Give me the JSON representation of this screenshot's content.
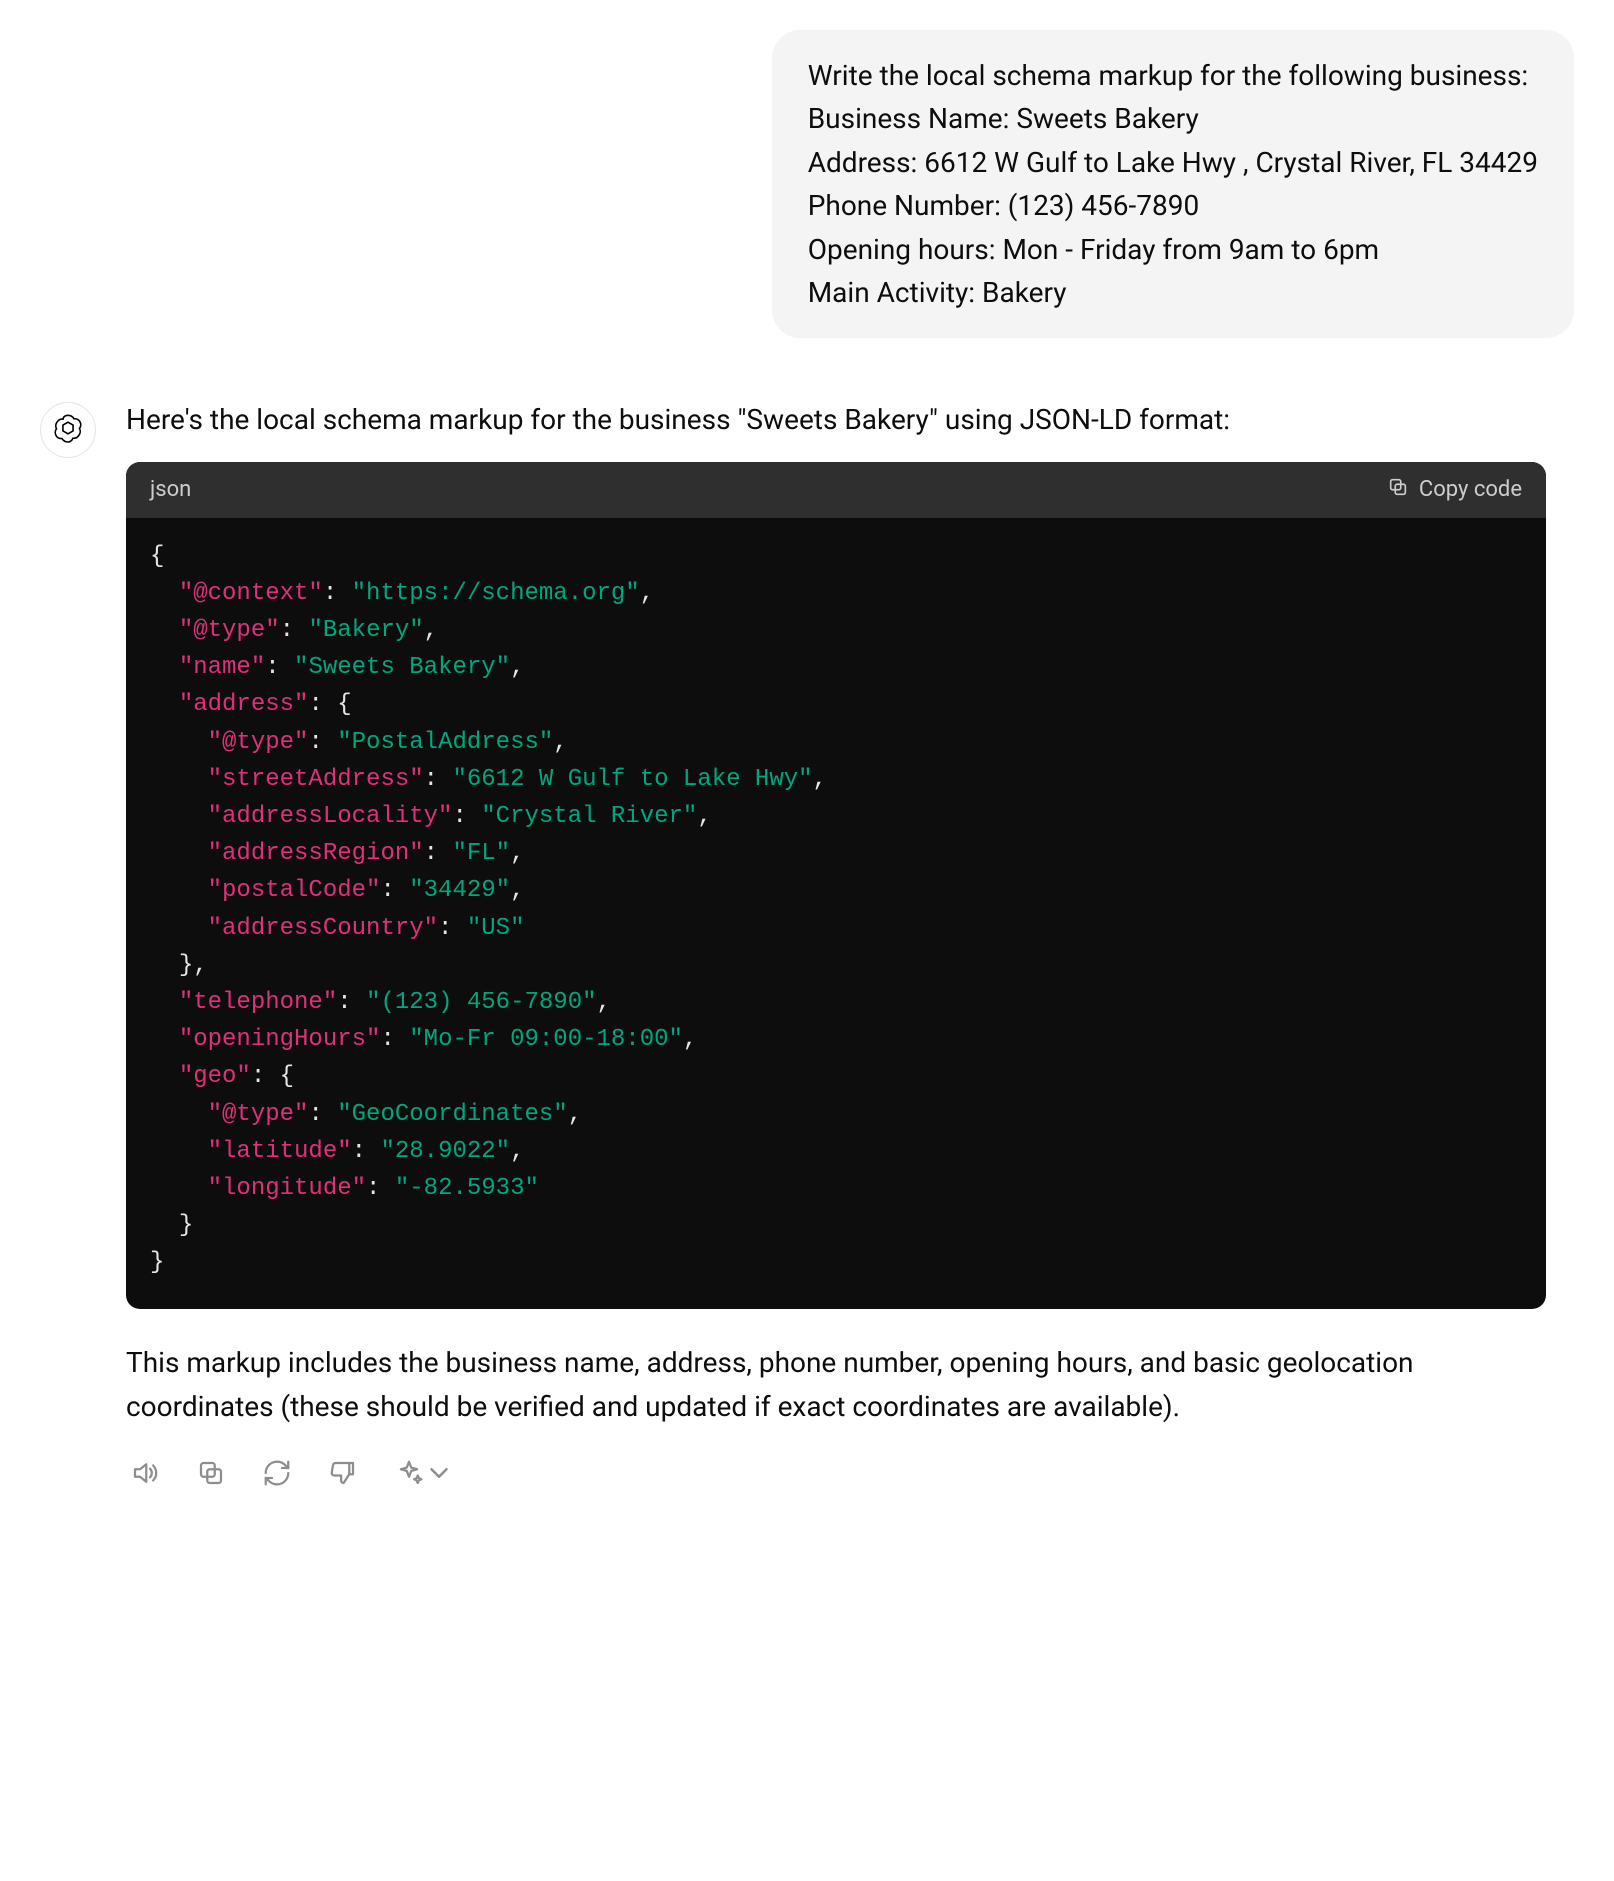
{
  "user_message": {
    "lines": [
      "Write the local schema markup for the following business:",
      "Business Name: Sweets Bakery",
      "Address: 6612 W Gulf to Lake Hwy , Crystal River, FL 34429",
      "Phone Number: (123) 456-7890",
      "Opening hours: Mon - Friday from 9am to 6pm",
      "Main Activity: Bakery"
    ]
  },
  "assistant": {
    "intro": "Here's the local schema markup for the business \"Sweets Bakery\" using JSON-LD format:",
    "code_lang": "json",
    "copy_label": "Copy code",
    "outro": "This markup includes the business name, address, phone number, opening hours, and basic geolocation coordinates (these should be verified and updated if exact coordinates are available).",
    "code_tokens": [
      {
        "t": "punc",
        "v": "{"
      },
      {
        "t": "nl"
      },
      {
        "t": "indent",
        "v": 1
      },
      {
        "t": "key",
        "v": "\"@context\""
      },
      {
        "t": "colon",
        "v": ": "
      },
      {
        "t": "str",
        "v": "\"https://schema.org\""
      },
      {
        "t": "punc",
        "v": ","
      },
      {
        "t": "nl"
      },
      {
        "t": "indent",
        "v": 1
      },
      {
        "t": "key",
        "v": "\"@type\""
      },
      {
        "t": "colon",
        "v": ": "
      },
      {
        "t": "str",
        "v": "\"Bakery\""
      },
      {
        "t": "punc",
        "v": ","
      },
      {
        "t": "nl"
      },
      {
        "t": "indent",
        "v": 1
      },
      {
        "t": "key",
        "v": "\"name\""
      },
      {
        "t": "colon",
        "v": ": "
      },
      {
        "t": "str",
        "v": "\"Sweets Bakery\""
      },
      {
        "t": "punc",
        "v": ","
      },
      {
        "t": "nl"
      },
      {
        "t": "indent",
        "v": 1
      },
      {
        "t": "key",
        "v": "\"address\""
      },
      {
        "t": "colon",
        "v": ": "
      },
      {
        "t": "punc",
        "v": "{"
      },
      {
        "t": "nl"
      },
      {
        "t": "indent",
        "v": 2
      },
      {
        "t": "key",
        "v": "\"@type\""
      },
      {
        "t": "colon",
        "v": ": "
      },
      {
        "t": "str",
        "v": "\"PostalAddress\""
      },
      {
        "t": "punc",
        "v": ","
      },
      {
        "t": "nl"
      },
      {
        "t": "indent",
        "v": 2
      },
      {
        "t": "key",
        "v": "\"streetAddress\""
      },
      {
        "t": "colon",
        "v": ": "
      },
      {
        "t": "str",
        "v": "\"6612 W Gulf to Lake Hwy\""
      },
      {
        "t": "punc",
        "v": ","
      },
      {
        "t": "nl"
      },
      {
        "t": "indent",
        "v": 2
      },
      {
        "t": "key",
        "v": "\"addressLocality\""
      },
      {
        "t": "colon",
        "v": ": "
      },
      {
        "t": "str",
        "v": "\"Crystal River\""
      },
      {
        "t": "punc",
        "v": ","
      },
      {
        "t": "nl"
      },
      {
        "t": "indent",
        "v": 2
      },
      {
        "t": "key",
        "v": "\"addressRegion\""
      },
      {
        "t": "colon",
        "v": ": "
      },
      {
        "t": "str",
        "v": "\"FL\""
      },
      {
        "t": "punc",
        "v": ","
      },
      {
        "t": "nl"
      },
      {
        "t": "indent",
        "v": 2
      },
      {
        "t": "key",
        "v": "\"postalCode\""
      },
      {
        "t": "colon",
        "v": ": "
      },
      {
        "t": "str",
        "v": "\"34429\""
      },
      {
        "t": "punc",
        "v": ","
      },
      {
        "t": "nl"
      },
      {
        "t": "indent",
        "v": 2
      },
      {
        "t": "key",
        "v": "\"addressCountry\""
      },
      {
        "t": "colon",
        "v": ": "
      },
      {
        "t": "str",
        "v": "\"US\""
      },
      {
        "t": "nl"
      },
      {
        "t": "indent",
        "v": 1
      },
      {
        "t": "punc",
        "v": "},"
      },
      {
        "t": "nl"
      },
      {
        "t": "indent",
        "v": 1
      },
      {
        "t": "key",
        "v": "\"telephone\""
      },
      {
        "t": "colon",
        "v": ": "
      },
      {
        "t": "str",
        "v": "\"(123) 456-7890\""
      },
      {
        "t": "punc",
        "v": ","
      },
      {
        "t": "nl"
      },
      {
        "t": "indent",
        "v": 1
      },
      {
        "t": "key",
        "v": "\"openingHours\""
      },
      {
        "t": "colon",
        "v": ": "
      },
      {
        "t": "str",
        "v": "\"Mo-Fr 09:00-18:00\""
      },
      {
        "t": "punc",
        "v": ","
      },
      {
        "t": "nl"
      },
      {
        "t": "indent",
        "v": 1
      },
      {
        "t": "key",
        "v": "\"geo\""
      },
      {
        "t": "colon",
        "v": ": "
      },
      {
        "t": "punc",
        "v": "{"
      },
      {
        "t": "nl"
      },
      {
        "t": "indent",
        "v": 2
      },
      {
        "t": "key",
        "v": "\"@type\""
      },
      {
        "t": "colon",
        "v": ": "
      },
      {
        "t": "str",
        "v": "\"GeoCoordinates\""
      },
      {
        "t": "punc",
        "v": ","
      },
      {
        "t": "nl"
      },
      {
        "t": "indent",
        "v": 2
      },
      {
        "t": "key",
        "v": "\"latitude\""
      },
      {
        "t": "colon",
        "v": ": "
      },
      {
        "t": "str",
        "v": "\"28.9022\""
      },
      {
        "t": "punc",
        "v": ","
      },
      {
        "t": "nl"
      },
      {
        "t": "indent",
        "v": 2
      },
      {
        "t": "key",
        "v": "\"longitude\""
      },
      {
        "t": "colon",
        "v": ": "
      },
      {
        "t": "str",
        "v": "\"-82.5933\""
      },
      {
        "t": "nl"
      },
      {
        "t": "indent",
        "v": 1
      },
      {
        "t": "punc",
        "v": "}"
      },
      {
        "t": "nl"
      },
      {
        "t": "punc",
        "v": "}"
      }
    ]
  },
  "actions": {
    "read_aloud": "Read aloud",
    "copy": "Copy",
    "regenerate": "Regenerate",
    "bad_response": "Bad response",
    "change_model": "Change model"
  }
}
